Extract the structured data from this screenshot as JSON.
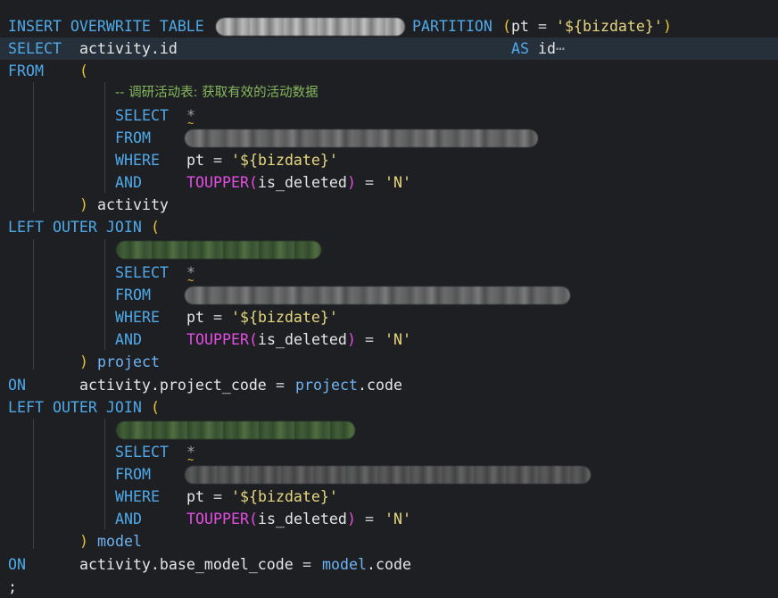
{
  "lines": {
    "l1": {
      "insert": "INSERT OVERWRITE TABLE",
      "partition": "PARTITION",
      "open": "(",
      "pt": "pt",
      "eq": "=",
      "bizdate": "'${bizdate}'",
      "close": ")"
    },
    "l2": {
      "select": "SELECT",
      "col": "activity.id",
      "as": "AS",
      "alias": "id",
      "ellipsis": "⋯"
    },
    "l3": {
      "from": "FROM",
      "open": "("
    },
    "l4": {
      "comment": "-- 调研活动表: 获取有效的活动数据"
    },
    "sub_select": "SELECT",
    "sub_star": "*",
    "sub_from": "FROM",
    "sub_where": "WHERE",
    "sub_pt": "pt",
    "sub_eq": "=",
    "sub_bizdate": "'${bizdate}'",
    "sub_and": "AND",
    "sub_toupper": "TOUPPER",
    "sub_arg_open": "(",
    "sub_arg": "is_deleted",
    "sub_arg_close": ")",
    "sub_eq2": "=",
    "sub_n": "'N'",
    "close_paren": ")",
    "l9": {
      "alias": "activity"
    },
    "left_outer_join": "LEFT OUTER JOIN",
    "join_open": "(",
    "l16": {
      "alias": "project"
    },
    "l17": {
      "on": "ON",
      "lhs": "activity.project_code",
      "eq": "=",
      "rhs_obj": "project",
      "rhs_field": ".code"
    },
    "l24": {
      "alias": "model"
    },
    "l25": {
      "on": "ON",
      "lhs": "activity.base_model_code",
      "eq": "=",
      "rhs_obj": "model",
      "rhs_field": ".code"
    },
    "l26": {
      "semicolon": ";"
    }
  },
  "colors": {
    "background": "#1e1f22",
    "keyword": "#4fa9e9",
    "string": "#e7d77f",
    "function": "#e24ee0",
    "comment": "#86b85e",
    "paren": "#e8c13a",
    "current_line": "#25303a"
  }
}
